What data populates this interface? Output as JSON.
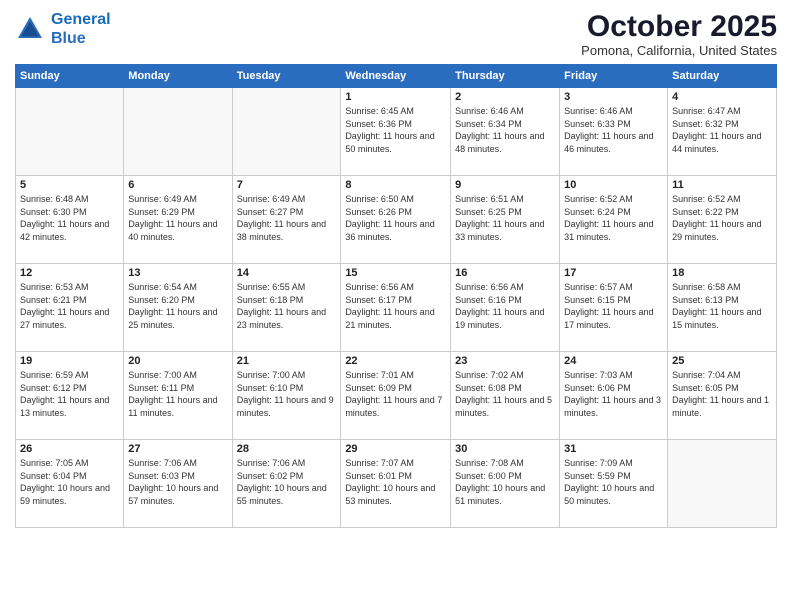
{
  "header": {
    "logo_line1": "General",
    "logo_line2": "Blue",
    "month_title": "October 2025",
    "location": "Pomona, California, United States"
  },
  "weekdays": [
    "Sunday",
    "Monday",
    "Tuesday",
    "Wednesday",
    "Thursday",
    "Friday",
    "Saturday"
  ],
  "weeks": [
    [
      {
        "day": "",
        "empty": true
      },
      {
        "day": "",
        "empty": true
      },
      {
        "day": "",
        "empty": true
      },
      {
        "day": "1",
        "sunrise": "6:45 AM",
        "sunset": "6:36 PM",
        "daylight": "11 hours and 50 minutes."
      },
      {
        "day": "2",
        "sunrise": "6:46 AM",
        "sunset": "6:34 PM",
        "daylight": "11 hours and 48 minutes."
      },
      {
        "day": "3",
        "sunrise": "6:46 AM",
        "sunset": "6:33 PM",
        "daylight": "11 hours and 46 minutes."
      },
      {
        "day": "4",
        "sunrise": "6:47 AM",
        "sunset": "6:32 PM",
        "daylight": "11 hours and 44 minutes."
      }
    ],
    [
      {
        "day": "5",
        "sunrise": "6:48 AM",
        "sunset": "6:30 PM",
        "daylight": "11 hours and 42 minutes."
      },
      {
        "day": "6",
        "sunrise": "6:49 AM",
        "sunset": "6:29 PM",
        "daylight": "11 hours and 40 minutes."
      },
      {
        "day": "7",
        "sunrise": "6:49 AM",
        "sunset": "6:27 PM",
        "daylight": "11 hours and 38 minutes."
      },
      {
        "day": "8",
        "sunrise": "6:50 AM",
        "sunset": "6:26 PM",
        "daylight": "11 hours and 36 minutes."
      },
      {
        "day": "9",
        "sunrise": "6:51 AM",
        "sunset": "6:25 PM",
        "daylight": "11 hours and 33 minutes."
      },
      {
        "day": "10",
        "sunrise": "6:52 AM",
        "sunset": "6:24 PM",
        "daylight": "11 hours and 31 minutes."
      },
      {
        "day": "11",
        "sunrise": "6:52 AM",
        "sunset": "6:22 PM",
        "daylight": "11 hours and 29 minutes."
      }
    ],
    [
      {
        "day": "12",
        "sunrise": "6:53 AM",
        "sunset": "6:21 PM",
        "daylight": "11 hours and 27 minutes."
      },
      {
        "day": "13",
        "sunrise": "6:54 AM",
        "sunset": "6:20 PM",
        "daylight": "11 hours and 25 minutes."
      },
      {
        "day": "14",
        "sunrise": "6:55 AM",
        "sunset": "6:18 PM",
        "daylight": "11 hours and 23 minutes."
      },
      {
        "day": "15",
        "sunrise": "6:56 AM",
        "sunset": "6:17 PM",
        "daylight": "11 hours and 21 minutes."
      },
      {
        "day": "16",
        "sunrise": "6:56 AM",
        "sunset": "6:16 PM",
        "daylight": "11 hours and 19 minutes."
      },
      {
        "day": "17",
        "sunrise": "6:57 AM",
        "sunset": "6:15 PM",
        "daylight": "11 hours and 17 minutes."
      },
      {
        "day": "18",
        "sunrise": "6:58 AM",
        "sunset": "6:13 PM",
        "daylight": "11 hours and 15 minutes."
      }
    ],
    [
      {
        "day": "19",
        "sunrise": "6:59 AM",
        "sunset": "6:12 PM",
        "daylight": "11 hours and 13 minutes."
      },
      {
        "day": "20",
        "sunrise": "7:00 AM",
        "sunset": "6:11 PM",
        "daylight": "11 hours and 11 minutes."
      },
      {
        "day": "21",
        "sunrise": "7:00 AM",
        "sunset": "6:10 PM",
        "daylight": "11 hours and 9 minutes."
      },
      {
        "day": "22",
        "sunrise": "7:01 AM",
        "sunset": "6:09 PM",
        "daylight": "11 hours and 7 minutes."
      },
      {
        "day": "23",
        "sunrise": "7:02 AM",
        "sunset": "6:08 PM",
        "daylight": "11 hours and 5 minutes."
      },
      {
        "day": "24",
        "sunrise": "7:03 AM",
        "sunset": "6:06 PM",
        "daylight": "11 hours and 3 minutes."
      },
      {
        "day": "25",
        "sunrise": "7:04 AM",
        "sunset": "6:05 PM",
        "daylight": "11 hours and 1 minute."
      }
    ],
    [
      {
        "day": "26",
        "sunrise": "7:05 AM",
        "sunset": "6:04 PM",
        "daylight": "10 hours and 59 minutes."
      },
      {
        "day": "27",
        "sunrise": "7:06 AM",
        "sunset": "6:03 PM",
        "daylight": "10 hours and 57 minutes."
      },
      {
        "day": "28",
        "sunrise": "7:06 AM",
        "sunset": "6:02 PM",
        "daylight": "10 hours and 55 minutes."
      },
      {
        "day": "29",
        "sunrise": "7:07 AM",
        "sunset": "6:01 PM",
        "daylight": "10 hours and 53 minutes."
      },
      {
        "day": "30",
        "sunrise": "7:08 AM",
        "sunset": "6:00 PM",
        "daylight": "10 hours and 51 minutes."
      },
      {
        "day": "31",
        "sunrise": "7:09 AM",
        "sunset": "5:59 PM",
        "daylight": "10 hours and 50 minutes."
      },
      {
        "day": "",
        "empty": true
      }
    ]
  ]
}
